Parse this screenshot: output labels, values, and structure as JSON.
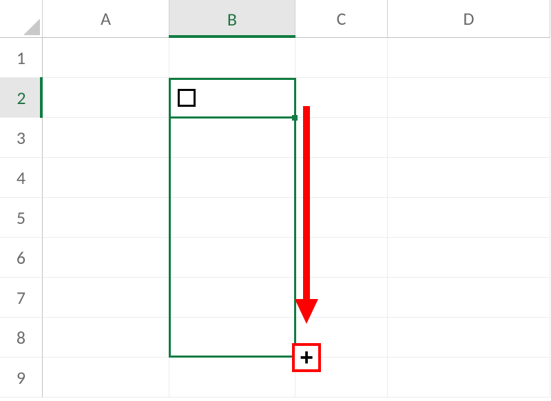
{
  "columns": {
    "A": "A",
    "B": "B",
    "C": "C",
    "D": "D"
  },
  "rows": {
    "1": "1",
    "2": "2",
    "3": "3",
    "4": "4",
    "5": "5",
    "6": "6",
    "7": "7",
    "8": "8",
    "9": "9"
  },
  "active_cell": "B2",
  "fill_preview_range": "B2:B8",
  "cells": {
    "B2": {
      "content_type": "checkbox",
      "checked": false
    }
  },
  "annotation": {
    "arrow_color": "#ff0000",
    "cursor_label": "+"
  },
  "selection_color": "#107c41"
}
